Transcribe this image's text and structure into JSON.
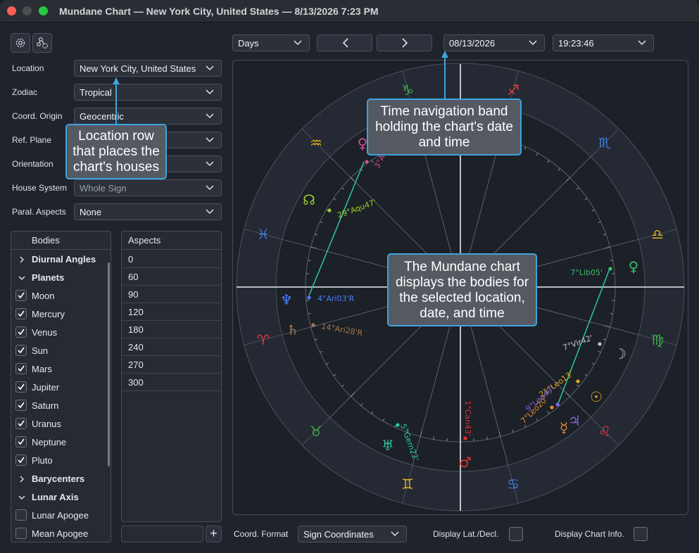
{
  "window": {
    "title": "Mundane Chart — New York City, United States — 8/13/2026 7:23 PM"
  },
  "toolbar": {
    "period": "Days",
    "date": "08/13/2026",
    "time": "19:23:46"
  },
  "settings": [
    {
      "label": "Location",
      "value": "New York City, United States"
    },
    {
      "label": "Zodiac",
      "value": "Tropical"
    },
    {
      "label": "Coord. Origin",
      "value": "Geocentric"
    },
    {
      "label": "Ref. Plane",
      "value": ""
    },
    {
      "label": "Orientation",
      "value": ""
    },
    {
      "label": "House System",
      "value": "Whole Sign"
    },
    {
      "label": "Paral. Aspects",
      "value": "None"
    }
  ],
  "bodies": {
    "header": "Bodies",
    "items": [
      {
        "label": "Diurnal Angles",
        "kind": "group",
        "expanded": false
      },
      {
        "label": "Planets",
        "kind": "group",
        "expanded": true
      },
      {
        "label": "Moon",
        "kind": "item",
        "checked": true
      },
      {
        "label": "Mercury",
        "kind": "item",
        "checked": true
      },
      {
        "label": "Venus",
        "kind": "item",
        "checked": true
      },
      {
        "label": "Sun",
        "kind": "item",
        "checked": true
      },
      {
        "label": "Mars",
        "kind": "item",
        "checked": true
      },
      {
        "label": "Jupiter",
        "kind": "item",
        "checked": true
      },
      {
        "label": "Saturn",
        "kind": "item",
        "checked": true
      },
      {
        "label": "Uranus",
        "kind": "item",
        "checked": true
      },
      {
        "label": "Neptune",
        "kind": "item",
        "checked": true
      },
      {
        "label": "Pluto",
        "kind": "item",
        "checked": true
      },
      {
        "label": "Barycenters",
        "kind": "group",
        "expanded": false
      },
      {
        "label": "Lunar Axis",
        "kind": "group",
        "expanded": true
      },
      {
        "label": "Lunar Apogee",
        "kind": "item",
        "checked": false
      },
      {
        "label": "Mean Apogee",
        "kind": "item",
        "checked": false
      }
    ]
  },
  "aspects": {
    "header": "Aspects",
    "items": [
      "0",
      "60",
      "90",
      "120",
      "180",
      "240",
      "270",
      "300"
    ],
    "add_label": "+"
  },
  "footer": {
    "coord_format_label": "Coord. Format",
    "coord_format_value": "Sign Coordinates",
    "lat_decl_label": "Display Lat./Decl.",
    "chart_info_label": "Display Chart Info."
  },
  "chart": {
    "signs": [
      {
        "glyph": "♑",
        "color": "#3fae49"
      },
      {
        "glyph": "♐",
        "color": "#e23a3a"
      },
      {
        "glyph": "♏",
        "color": "#3c7fe0"
      },
      {
        "glyph": "♎",
        "color": "#e0b020"
      },
      {
        "glyph": "♍",
        "color": "#3fae49"
      },
      {
        "glyph": "♌",
        "color": "#e23a3a"
      },
      {
        "glyph": "♋",
        "color": "#3c7fe0"
      },
      {
        "glyph": "♊",
        "color": "#e0b020"
      },
      {
        "glyph": "♉",
        "color": "#3fae49"
      },
      {
        "glyph": "♈",
        "color": "#e23a3a"
      },
      {
        "glyph": "♓",
        "color": "#3c7fe0"
      },
      {
        "glyph": "♒",
        "color": "#e0b020"
      }
    ],
    "bodies": [
      {
        "glyph": "♀",
        "label": "3°Aqu52'R",
        "color": "#d0508a"
      },
      {
        "glyph": "☊",
        "label": "29°Aqu47'",
        "color": "#9acd32"
      },
      {
        "glyph": "♆",
        "label": "4°Ari03'R",
        "color": "#4a7fff"
      },
      {
        "glyph": "♄",
        "label": "14°Ari28'R",
        "color": "#a07850"
      },
      {
        "glyph": "♀",
        "label": "7°Lib05'",
        "color": "#3cbd6a"
      },
      {
        "glyph": "☽",
        "label": "7°Vir42'",
        "color": "#c0c0c0"
      },
      {
        "glyph": "☉",
        "label": "21°Leo13'",
        "color": "#e0a820"
      },
      {
        "glyph": "♃",
        "label": "9°Leo49'",
        "color": "#8060e0"
      },
      {
        "glyph": "☿",
        "label": "7°Leo20'",
        "color": "#e08a30"
      },
      {
        "glyph": "♅",
        "label": "5°Gem22'",
        "color": "#2ec7a0"
      },
      {
        "glyph": "♂",
        "label": "1°Can43'",
        "color": "#e03030"
      }
    ]
  },
  "callouts": {
    "time_nav": "Time navigation band holding the chart's date and time",
    "location": "Location row that places the chart's houses",
    "chart": "The Mundane chart displays the bodies for the selected location, date, and time"
  }
}
